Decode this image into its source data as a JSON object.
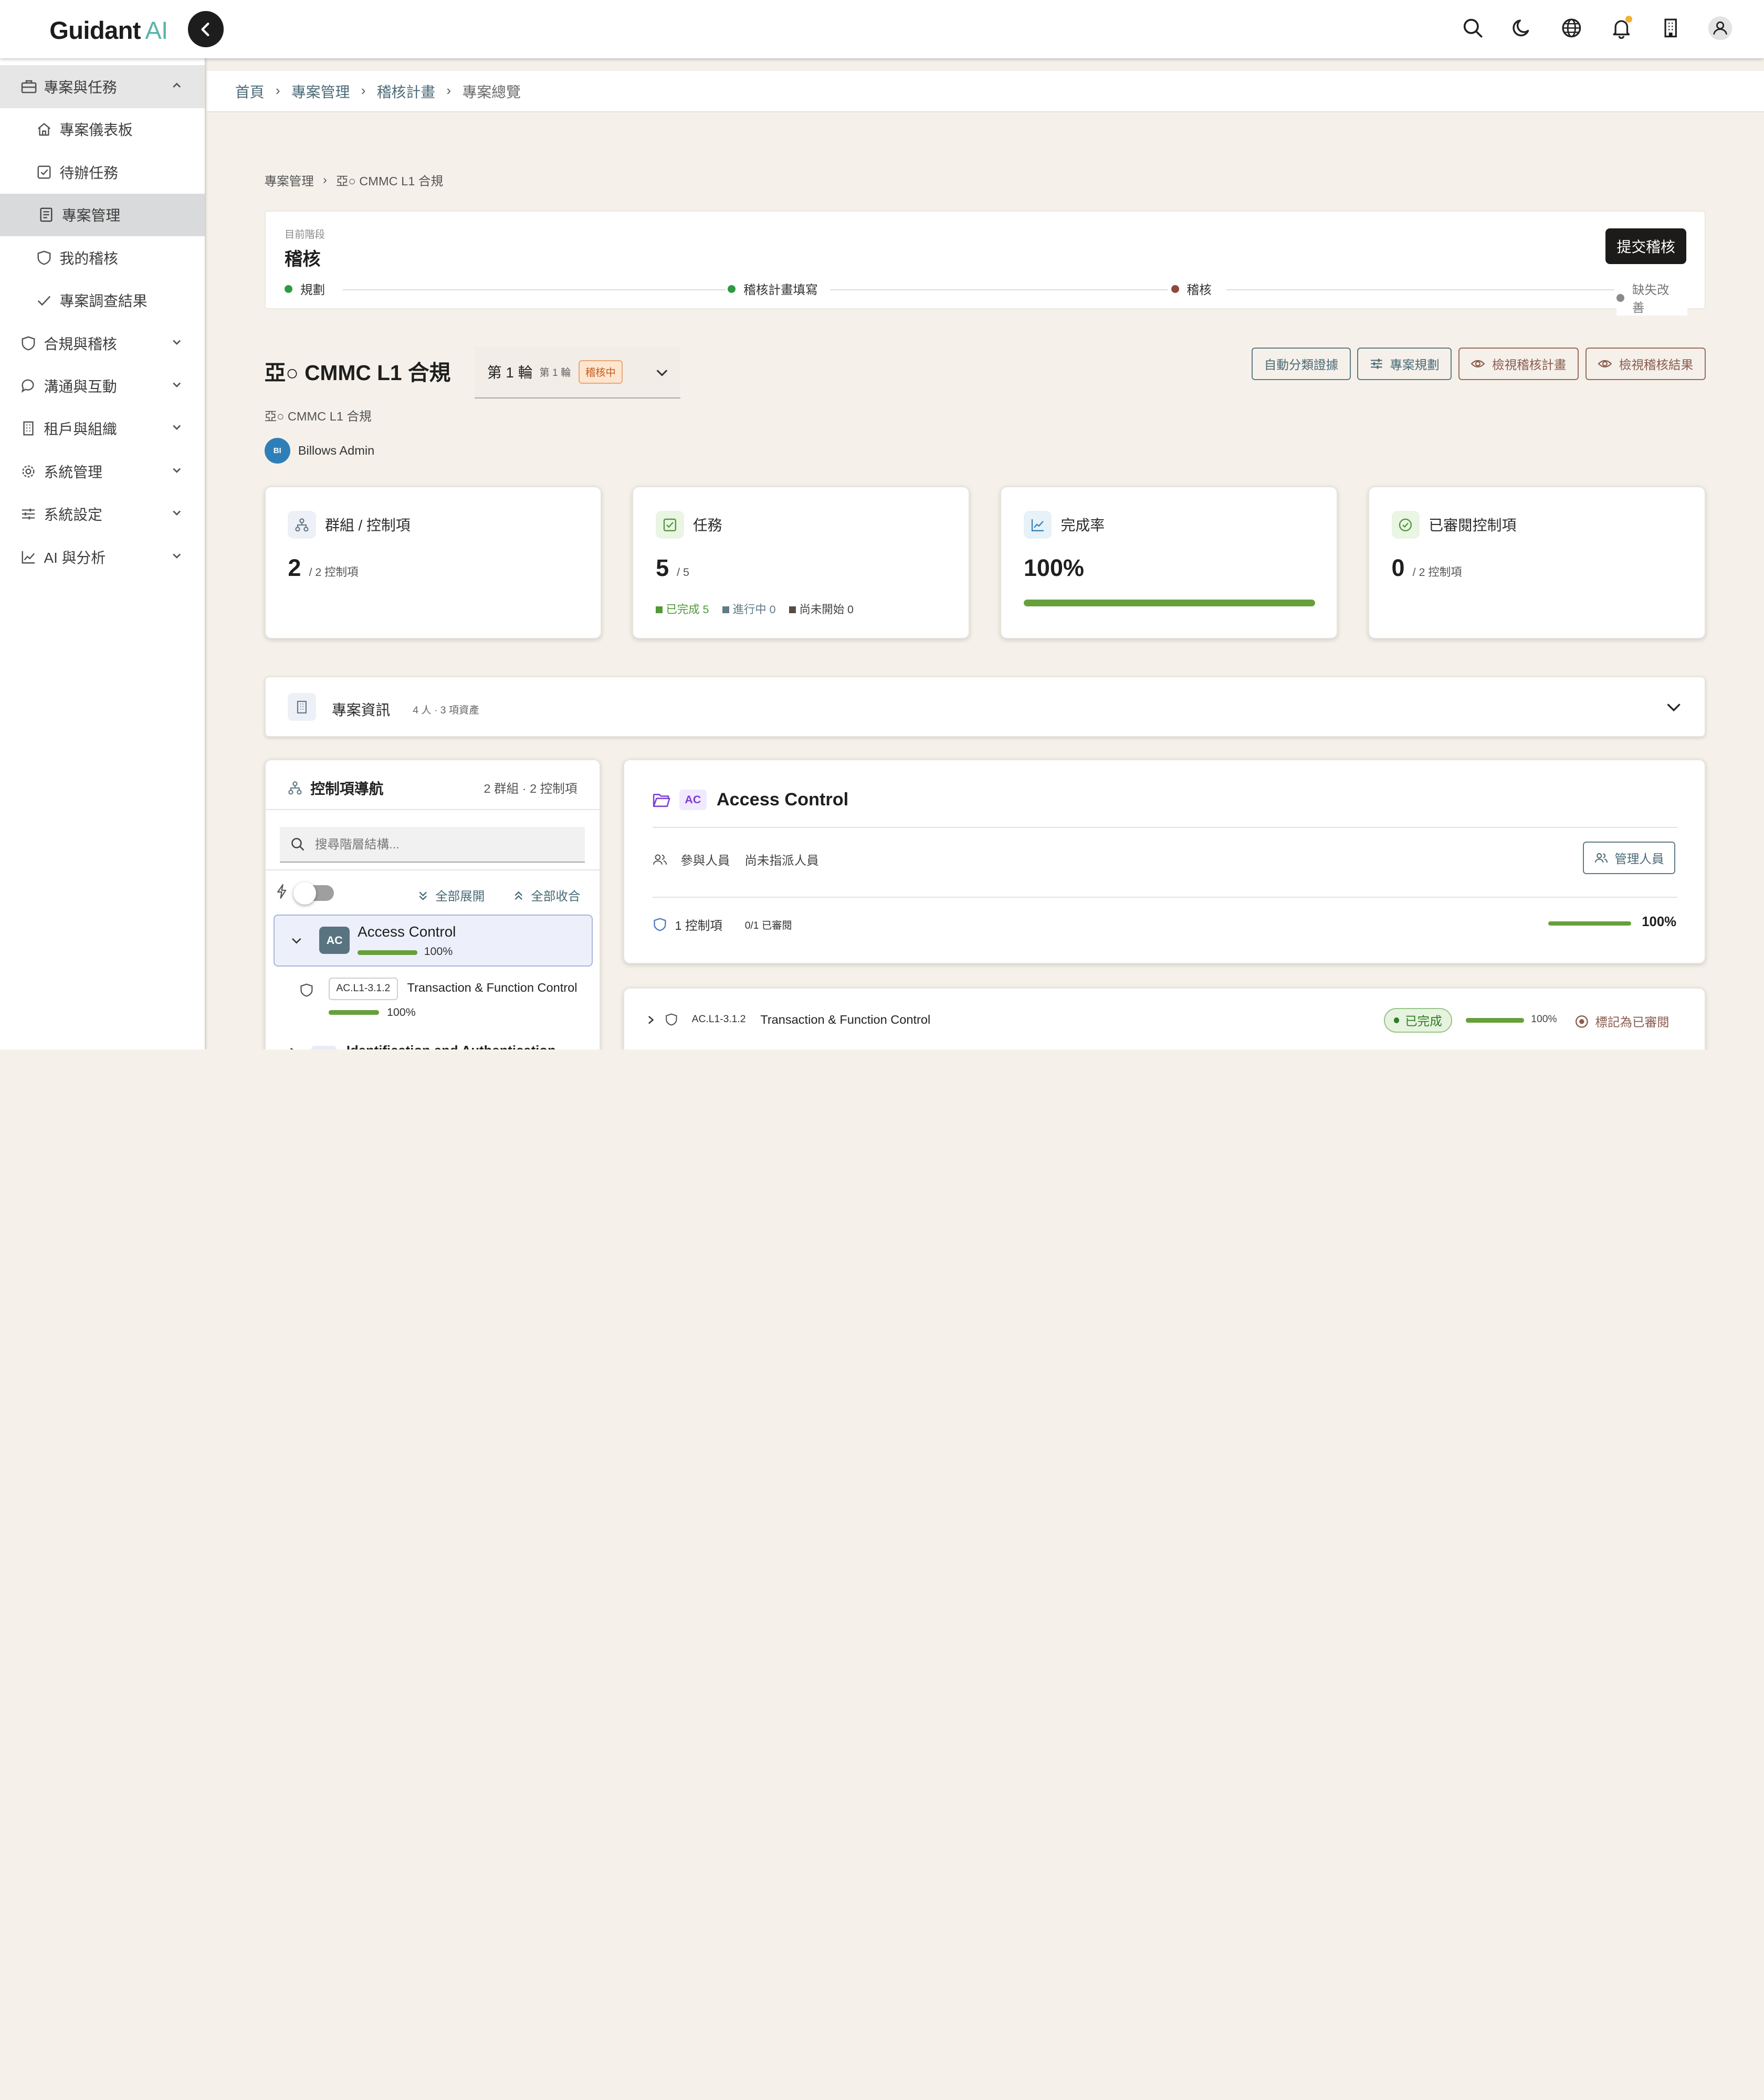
{
  "brand": {
    "name": "Guidant",
    "suffix": "AI"
  },
  "top_icons": [
    "search-icon",
    "moon-icon",
    "globe-icon",
    "bell-icon",
    "building-icon",
    "user-icon"
  ],
  "colors": {
    "accent": "#5ab4a8",
    "progress": "#67a03b",
    "audit_badge": "#c45c1b",
    "dark": "#1d1b19"
  },
  "sidebar": {
    "group_open": {
      "label": "專案與任務"
    },
    "sub_items": [
      {
        "label": "專案儀表板",
        "icon": "home-icon"
      },
      {
        "label": "待辦任務",
        "icon": "checkbox-icon"
      },
      {
        "label": "專案管理",
        "icon": "document-icon",
        "active": true
      },
      {
        "label": "我的稽核",
        "icon": "shield-icon"
      },
      {
        "label": "專案調查結果",
        "icon": "check-icon"
      }
    ],
    "groups": [
      {
        "label": "合規與稽核",
        "icon": "shield-icon"
      },
      {
        "label": "溝通與互動",
        "icon": "chat-icon"
      },
      {
        "label": "租戶與組織",
        "icon": "building-icon"
      },
      {
        "label": "系統管理",
        "icon": "gear-icon"
      },
      {
        "label": "系統設定",
        "icon": "sliders-icon"
      },
      {
        "label": "AI 與分析",
        "icon": "chart-icon"
      }
    ]
  },
  "breadcrumb": [
    "首頁",
    "專案管理",
    "稽核計畫",
    "專案總覽"
  ],
  "sub_breadcrumb": [
    "專案管理",
    "亞○ CMMC L1 合規"
  ],
  "phase": {
    "label": "目前階段",
    "value": "稽核",
    "submit": "提交稽核",
    "steps": [
      {
        "label": "規劃",
        "color": "#2e9a43"
      },
      {
        "label": "稽核計畫填寫",
        "color": "#2e9a43"
      },
      {
        "label": "稽核",
        "color": "#8b4a3c"
      },
      {
        "label": "缺失改善",
        "color": "#8a8a8a"
      }
    ]
  },
  "project": {
    "title": "亞○ CMMC L1 合規",
    "subtitle": "亞○ CMMC L1 合規",
    "round": "第 1 輪",
    "round_small": "第 1 輪",
    "status": "稽核中",
    "owner_initials": "BI",
    "owner": "Billows Admin"
  },
  "actions": [
    "自動分類證據",
    "專案規劃",
    "檢視稽核計畫",
    "檢視稽核結果"
  ],
  "stats": {
    "groups": {
      "title": "群組 / 控制項",
      "value": "2",
      "of": "/ 2 控制項"
    },
    "tasks": {
      "title": "任務",
      "value": "5",
      "of": "/ 5",
      "done": "已完成 5",
      "doing": "進行中 0",
      "todo": "尚未開始 0"
    },
    "completion": {
      "title": "完成率",
      "value": "100%",
      "progress": 1.0
    },
    "reviewed": {
      "title": "已審閱控制項",
      "value": "0",
      "of": "/ 2 控制項"
    }
  },
  "info": {
    "title": "專案資訊",
    "meta": "4 人 · 3 項資產"
  },
  "control_nav": {
    "title": "控制項導航",
    "count": "2 群組 · 2 控制項",
    "search_placeholder": "搜尋階層結構...",
    "expand_all": "全部展開",
    "collapse_all": "全部收合",
    "groups": [
      {
        "code": "AC",
        "name": "Access Control",
        "pct": "100%",
        "progress": 1.0
      },
      {
        "code": "",
        "name": "Identification and Authentication"
      }
    ],
    "child": {
      "code": "AC.L1-3.1.2",
      "name": "Transaction & Function Control",
      "pct": "100%",
      "progress": 1.0
    }
  },
  "detail": {
    "code": "AC",
    "title": "Access Control",
    "participants_label": "參與人員",
    "participants_value": "尚未指派人員",
    "manage": "管理人員",
    "controls": "1 控制項",
    "reviewed": "0/1 已審閱",
    "pct": "100%",
    "progress": 1.0
  },
  "control_row": {
    "code": "AC.L1-3.1.2",
    "name": "Transaction & Function Control",
    "status": "已完成",
    "pct": "100%",
    "progress": 1.0,
    "mark": "標記為已審閱"
  }
}
